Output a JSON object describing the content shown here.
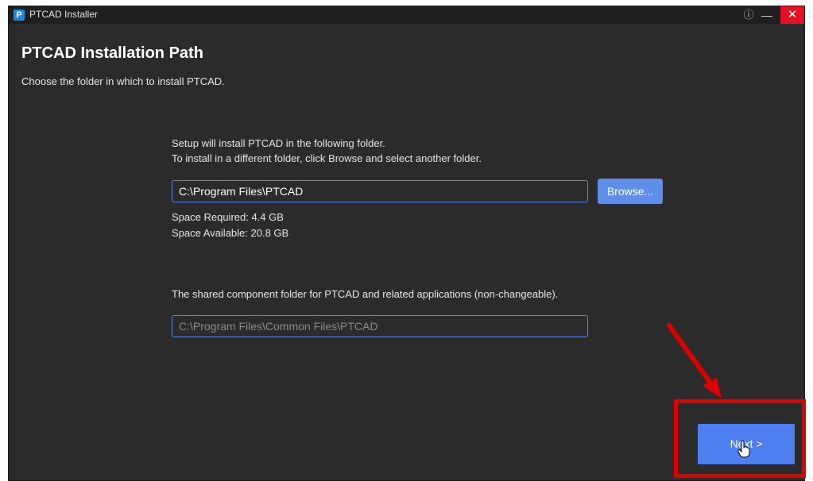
{
  "window": {
    "title": "PTCAD Installer",
    "app_icon_glyph": "P",
    "info_icon": "info-icon",
    "minimize_icon": "minimize-icon",
    "close_icon": "close-icon",
    "info_glyph": "ⓘ",
    "minimize_glyph": "—",
    "close_glyph": "✕"
  },
  "page": {
    "title": "PTCAD Installation Path",
    "subtitle": "Choose the folder in which to install PTCAD."
  },
  "install": {
    "intro_line1": "Setup will install PTCAD in the following folder.",
    "intro_line2": "To install in a different folder, click Browse and select another folder.",
    "path_value": "C:\\Program Files\\PTCAD",
    "browse_label": "Browse...",
    "space_required": "Space Required: 4.4 GB",
    "space_available": "Space Available: 20.8 GB"
  },
  "shared": {
    "description": "The shared component folder for PTCAD and related applications (non-changeable).",
    "path_value": "C:\\Program Files\\Common Files\\PTCAD"
  },
  "footer": {
    "next_label": "Next >"
  },
  "colors": {
    "window_bg": "#2b2b2b",
    "titlebar_bg": "#1f1f1f",
    "accent": "#4f7ef0",
    "close_red": "#e81123",
    "annotation_red": "#e00000"
  }
}
